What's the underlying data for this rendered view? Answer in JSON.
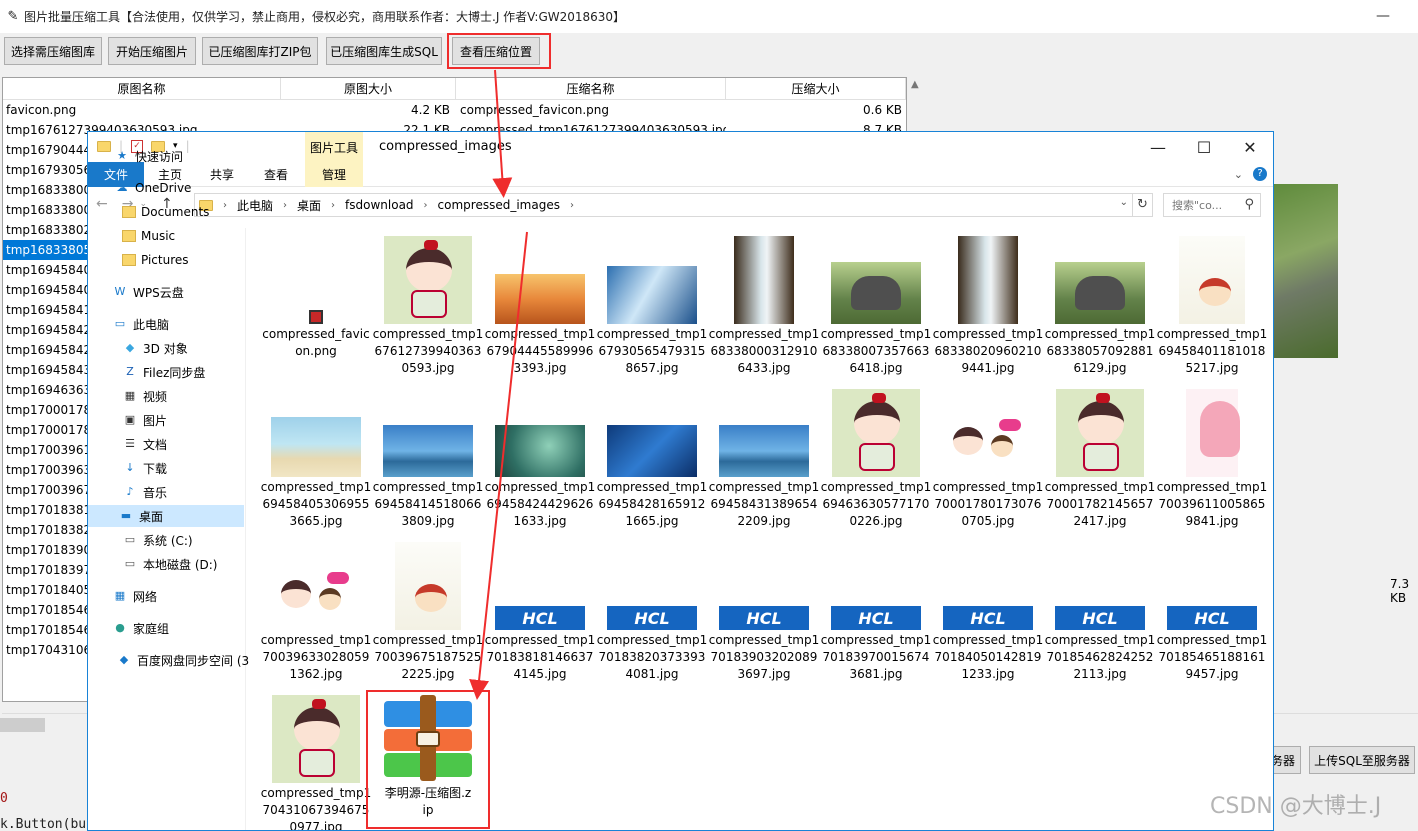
{
  "app": {
    "title": "图片批量压缩工具【合法使用，仅供学习，禁止商用，侵权必究，商用联系作者：大博士.J 作者V:GW2018630】",
    "minimize_label": "—",
    "toolbar": {
      "select_label": "选择需压缩图库",
      "start_label": "开始压缩图片",
      "zip_label": "已压缩图库打ZIP包",
      "sql_label": "已压缩图库生成SQL",
      "view_label": "查看压缩位置"
    },
    "table": {
      "headers": [
        "原图名称",
        "原图大小",
        "压缩名称",
        "压缩大小"
      ],
      "rows": [
        {
          "name": "favicon.png",
          "size": "4.2 KB",
          "cname": "compressed_favicon.png",
          "csize": "0.6 KB"
        },
        {
          "name": "tmp1676127399403630593.jpg",
          "size": "22.1 KB",
          "cname": "compressed_tmp1676127399403630593.jpg",
          "csize": "8.7 KB"
        },
        {
          "name": "tmp16790444",
          "size": "",
          "cname": "",
          "csize": ""
        },
        {
          "name": "tmp16793056",
          "size": "",
          "cname": "",
          "csize": ""
        },
        {
          "name": "tmp16833800",
          "size": "",
          "cname": "",
          "csize": ""
        },
        {
          "name": "tmp16833800",
          "size": "",
          "cname": "",
          "csize": ""
        },
        {
          "name": "tmp16833802",
          "size": "",
          "cname": "",
          "csize": ""
        },
        {
          "name": "tmp16833805",
          "size": "",
          "cname": "",
          "csize": ""
        },
        {
          "name": "tmp16945840",
          "size": "",
          "cname": "",
          "csize": ""
        },
        {
          "name": "tmp16945840",
          "size": "",
          "cname": "",
          "csize": ""
        },
        {
          "name": "tmp16945841",
          "size": "",
          "cname": "",
          "csize": ""
        },
        {
          "name": "tmp16945842",
          "size": "",
          "cname": "",
          "csize": ""
        },
        {
          "name": "tmp16945842",
          "size": "",
          "cname": "",
          "csize": ""
        },
        {
          "name": "tmp16945843",
          "size": "",
          "cname": "",
          "csize": ""
        },
        {
          "name": "tmp16946363",
          "size": "",
          "cname": "",
          "csize": ""
        },
        {
          "name": "tmp17000178",
          "size": "",
          "cname": "",
          "csize": ""
        },
        {
          "name": "tmp17000178",
          "size": "",
          "cname": "",
          "csize": ""
        },
        {
          "name": "tmp17003961",
          "size": "",
          "cname": "",
          "csize": ""
        },
        {
          "name": "tmp17003963",
          "size": "",
          "cname": "",
          "csize": ""
        },
        {
          "name": "tmp17003967",
          "size": "",
          "cname": "",
          "csize": ""
        },
        {
          "name": "tmp17018381",
          "size": "",
          "cname": "",
          "csize": ""
        },
        {
          "name": "tmp17018382",
          "size": "",
          "cname": "",
          "csize": ""
        },
        {
          "name": "tmp17018390",
          "size": "",
          "cname": "",
          "csize": ""
        },
        {
          "name": "tmp17018397",
          "size": "",
          "cname": "",
          "csize": ""
        },
        {
          "name": "tmp17018405",
          "size": "",
          "cname": "",
          "csize": ""
        },
        {
          "name": "tmp17018546",
          "size": "",
          "cname": "",
          "csize": ""
        },
        {
          "name": "tmp17018546",
          "size": "",
          "cname": "",
          "csize": ""
        },
        {
          "name": "tmp17043106",
          "size": "",
          "cname": "",
          "csize": ""
        }
      ],
      "selected_row": 7
    },
    "right_size": "7.3 KB",
    "bottom_buttons": {
      "server_label": "务器",
      "upload_sql_label": "上传SQL至服务器"
    },
    "code_zero": "0",
    "code_line": "k.Button(bu"
  },
  "explorer": {
    "pic_tools_label": "图片工具",
    "title": "compressed_images",
    "window_buttons": {
      "minimize": "—",
      "maximize": "☐",
      "close": "✕"
    },
    "ribbon": {
      "file": "文件",
      "home": "主页",
      "share": "共享",
      "view": "查看",
      "manage": "管理"
    },
    "breadcrumb": [
      "此电脑",
      "桌面",
      "fsdownload",
      "compressed_images"
    ],
    "search_placeholder": "搜索\"co...",
    "nav": [
      {
        "label": "快速访问",
        "icon": "star-icon"
      },
      {
        "label": "OneDrive",
        "icon": "cloud-icon"
      },
      {
        "label": "Documents",
        "icon": "folder-icon"
      },
      {
        "label": "Music",
        "icon": "folder-icon"
      },
      {
        "label": "Pictures",
        "icon": "folder-icon"
      },
      {
        "label": "WPS云盘",
        "icon": "wps-icon"
      },
      {
        "label": "此电脑",
        "icon": "computer-icon"
      },
      {
        "label": "3D 对象",
        "icon": "cube-icon"
      },
      {
        "label": "Filez同步盘",
        "icon": "filez-icon"
      },
      {
        "label": "视频",
        "icon": "video-icon"
      },
      {
        "label": "图片",
        "icon": "picture-icon"
      },
      {
        "label": "文档",
        "icon": "document-icon"
      },
      {
        "label": "下载",
        "icon": "download-icon"
      },
      {
        "label": "音乐",
        "icon": "music-icon"
      },
      {
        "label": "桌面",
        "icon": "desktop-icon"
      },
      {
        "label": "系统 (C:)",
        "icon": "drive-icon"
      },
      {
        "label": "本地磁盘 (D:)",
        "icon": "drive-icon"
      },
      {
        "label": "网络",
        "icon": "network-icon"
      },
      {
        "label": "家庭组",
        "icon": "homegroup-icon"
      },
      {
        "label": "百度网盘同步空间 (3",
        "icon": "baidu-sync-icon"
      }
    ],
    "nav_selected": 14,
    "files": [
      {
        "name": "compressed_favicon.png",
        "kind": "favicon"
      },
      {
        "name": "compressed_tmp1676127399403630593.jpg",
        "kind": "cartoon"
      },
      {
        "name": "compressed_tmp1679044455899963393.jpg",
        "kind": "sunset"
      },
      {
        "name": "compressed_tmp1679305654793158657.jpg",
        "kind": "abstract"
      },
      {
        "name": "compressed_tmp1683380003129106433.jpg",
        "kind": "water"
      },
      {
        "name": "compressed_tmp1683380073576636418.jpg",
        "kind": "elephant"
      },
      {
        "name": "compressed_tmp1683380209602109441.jpg",
        "kind": "water"
      },
      {
        "name": "compressed_tmp1683380570928816129.jpg",
        "kind": "elephant"
      },
      {
        "name": "compressed_tmp1694584011810185217.jpg",
        "kind": "girl"
      },
      {
        "name": "compressed_tmp1694584053069553665.jpg",
        "kind": "beach"
      },
      {
        "name": "compressed_tmp1694584145180663809.jpg",
        "kind": "bungalow"
      },
      {
        "name": "compressed_tmp1694584244296261633.jpg",
        "kind": "bird"
      },
      {
        "name": "compressed_tmp1694584281659121665.jpg",
        "kind": "blue"
      },
      {
        "name": "compressed_tmp1694584313896542209.jpg",
        "kind": "bungalow"
      },
      {
        "name": "compressed_tmp1694636305771700226.jpg",
        "kind": "cartoon"
      },
      {
        "name": "compressed_tmp1700017801730760705.jpg",
        "kind": "stickers"
      },
      {
        "name": "compressed_tmp1700017821456572417.jpg",
        "kind": "cartoon"
      },
      {
        "name": "compressed_tmp1700396110058659841.jpg",
        "kind": "pink"
      },
      {
        "name": "compressed_tmp1700396330280591362.jpg",
        "kind": "stickers"
      },
      {
        "name": "compressed_tmp1700396751875252225.jpg",
        "kind": "girl"
      },
      {
        "name": "compressed_tmp1701838181466374145.jpg",
        "kind": "hcl"
      },
      {
        "name": "compressed_tmp1701838203733934081.jpg",
        "kind": "hcl"
      },
      {
        "name": "compressed_tmp1701839032020893697.jpg",
        "kind": "hcl"
      },
      {
        "name": "compressed_tmp1701839700156743681.jpg",
        "kind": "hcl"
      },
      {
        "name": "compressed_tmp1701840501428191233.jpg",
        "kind": "hcl"
      },
      {
        "name": "compressed_tmp1701854628242522113.jpg",
        "kind": "hcl"
      },
      {
        "name": "compressed_tmp1701854651881619457.jpg",
        "kind": "hcl"
      },
      {
        "name": "compressed_tmp1704310673946750977.jpg",
        "kind": "cartoon"
      },
      {
        "name": "李明源-压缩图.zip",
        "kind": "zip"
      }
    ],
    "hcl_text": "HCL"
  },
  "watermark": "CSDN @大博士.J",
  "colors": {
    "highlight_red": "#ef2d2d",
    "selection_blue": "#0078d7",
    "explorer_accent": "#1979ca",
    "picture_tools": "#fdf3c2"
  }
}
